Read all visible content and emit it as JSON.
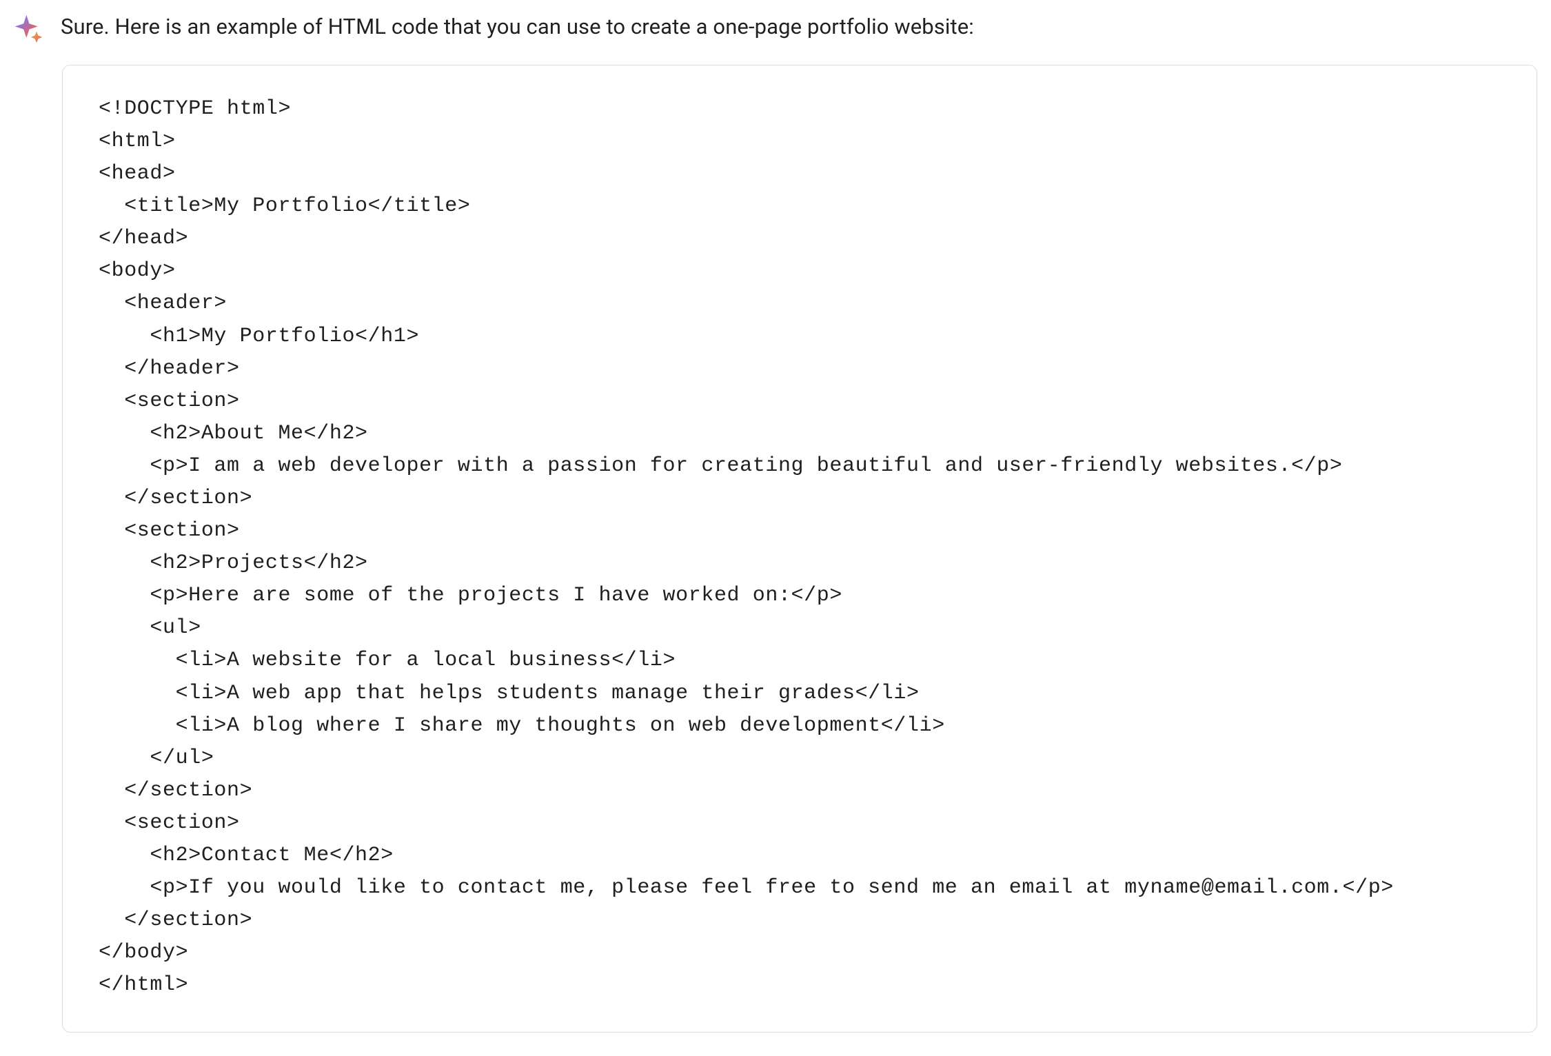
{
  "assistant": {
    "icon_name": "sparkle",
    "intro": "Sure. Here is an example of HTML code that you can use to create a one-page portfolio website:",
    "code": "<!DOCTYPE html>\n<html>\n<head>\n  <title>My Portfolio</title>\n</head>\n<body>\n  <header>\n    <h1>My Portfolio</h1>\n  </header>\n  <section>\n    <h2>About Me</h2>\n    <p>I am a web developer with a passion for creating beautiful and user-friendly websites.</p>\n  </section>\n  <section>\n    <h2>Projects</h2>\n    <p>Here are some of the projects I have worked on:</p>\n    <ul>\n      <li>A website for a local business</li>\n      <li>A web app that helps students manage their grades</li>\n      <li>A blog where I share my thoughts on web development</li>\n    </ul>\n  </section>\n  <section>\n    <h2>Contact Me</h2>\n    <p>If you would like to contact me, please feel free to send me an email at myname@email.com.</p>\n  </section>\n</body>\n</html>"
  }
}
